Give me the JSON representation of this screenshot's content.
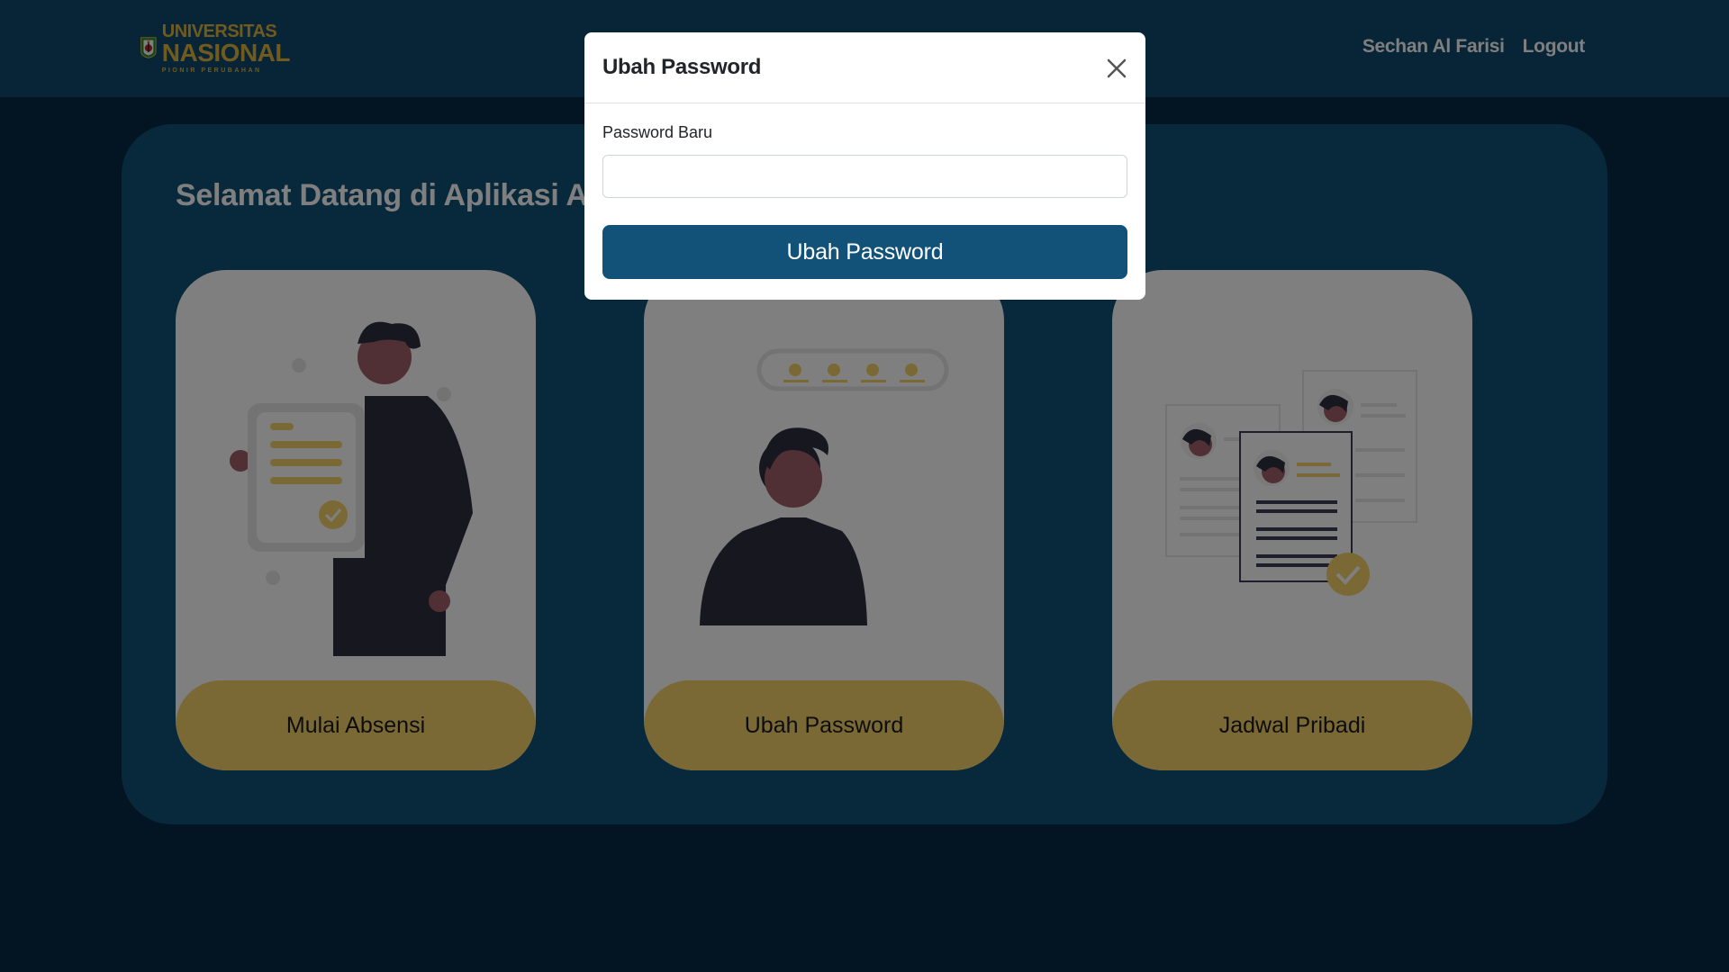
{
  "navbar": {
    "logo": {
      "line1": "UNIVERSITAS",
      "line2": "NASIONAL",
      "line3": "PIONIR PERUBAHAN",
      "icon": "university-shield-icon"
    },
    "user_name": "Sechan Al Farisi",
    "logout_label": "Logout"
  },
  "main": {
    "welcome": "Selamat Datang di Aplikasi Al",
    "cards": [
      {
        "label": "Mulai Absensi",
        "icon": "person-holding-document-illustration"
      },
      {
        "label": "Ubah Password",
        "icon": "person-password-illustration"
      },
      {
        "label": "Jadwal Pribadi",
        "icon": "profile-documents-illustration"
      }
    ]
  },
  "modal": {
    "title": "Ubah Password",
    "close_icon": "close-icon",
    "field_label": "Password Baru",
    "field_value": "",
    "field_placeholder": "",
    "submit_label": "Ubah Password"
  },
  "colors": {
    "navbar": "#0f4a6e",
    "background": "#062a45",
    "panel": "#105378",
    "card_button": "#f5d36b",
    "primary_button": "#135278",
    "logo_gold": "#e0b43c"
  }
}
